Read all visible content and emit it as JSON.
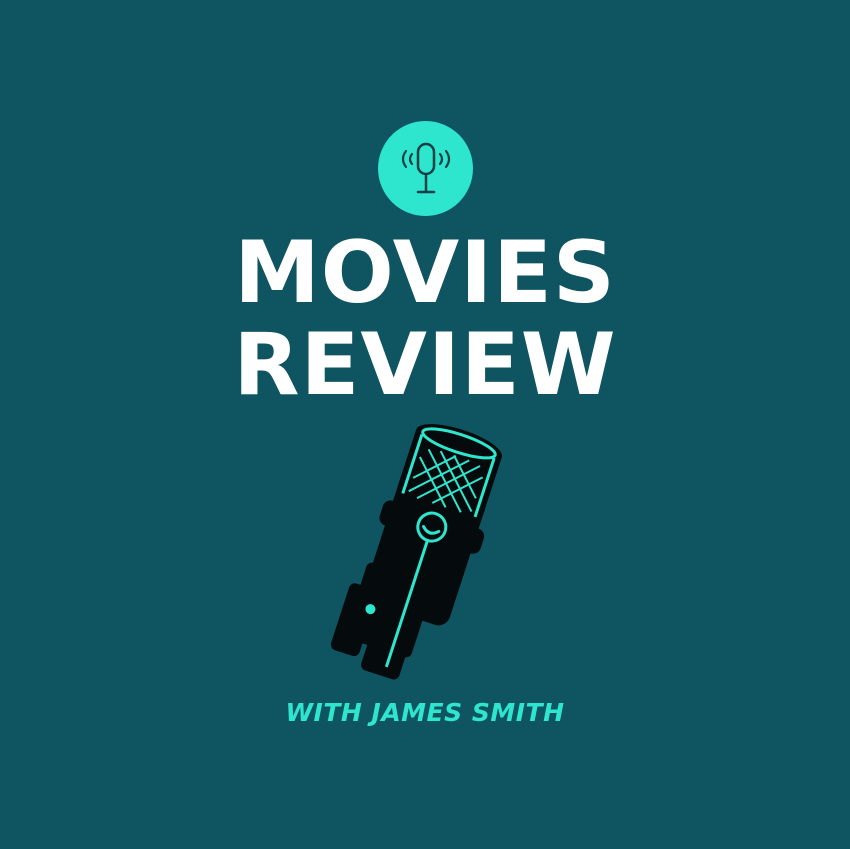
{
  "cover": {
    "title_line1": "MOVIES",
    "title_line2": "REVIEW",
    "subtitle": "WITH JAMES SMITH"
  },
  "icons": {
    "badge": "podcast-microphone-icon",
    "illustration": "studio-microphone-illustration"
  },
  "colors": {
    "background": "#0f5461",
    "accent": "#2ee6cd",
    "title_text": "#ffffff",
    "illustration_body": "#050a0c"
  }
}
